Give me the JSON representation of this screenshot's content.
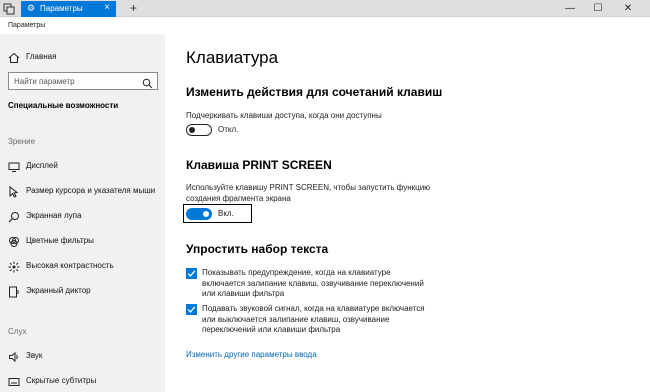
{
  "window": {
    "tab_title": "Параметры",
    "new_tab": "+",
    "app_title": "Параметры",
    "controls": {
      "minimize": "—",
      "maximize": "☐",
      "close": "✕"
    }
  },
  "sidebar": {
    "home": "Главная",
    "search_placeholder": "Найти параметр",
    "section": "Специальные возможности",
    "group_vision": "Зрение",
    "items_vision": [
      {
        "label": "Дисплей",
        "icon": "display-icon"
      },
      {
        "label": "Размер курсора и указателя мыши",
        "icon": "cursor-icon"
      },
      {
        "label": "Экранная лупа",
        "icon": "magnifier-icon"
      },
      {
        "label": "Цветные фильтры",
        "icon": "color-filter-icon"
      },
      {
        "label": "Высокая контрастность",
        "icon": "contrast-icon"
      },
      {
        "label": "Экранный диктор",
        "icon": "narrator-icon"
      }
    ],
    "group_hearing": "Слух",
    "items_hearing": [
      {
        "label": "Звук",
        "icon": "speaker-icon"
      },
      {
        "label": "Скрытые субтитры",
        "icon": "captions-icon"
      }
    ]
  },
  "main": {
    "title": "Клавиатура",
    "section1": {
      "heading": "Изменить действия для сочетаний клавиш",
      "desc": "Подчеркивать клавиши доступа, когда они доступны",
      "toggle_state": "Откл."
    },
    "section2": {
      "heading": "Клавиша PRINT SCREEN",
      "desc_line1": "Используйте клавишу PRINT SCREEN, чтобы запустить функцию",
      "desc_line2": "создания фрагмента экрана",
      "toggle_state": "Вкл."
    },
    "section3": {
      "heading": "Упростить набор текста",
      "check1_lines": [
        "Показывать предупреждение, когда на клавиатуре",
        "включается залипание клавиш, озвучивание переключений",
        "или клавиши фильтра"
      ],
      "check2_lines": [
        "Подавать звуковой сигнал, когда на клавиатуре включается",
        "или выключается залипание клавиш, озвучивание",
        "переключений или клавиши фильтра"
      ]
    },
    "link": "Изменить другие параметры ввода"
  },
  "colors": {
    "accent": "#0078d7",
    "sidebar_bg": "#f1f1f1",
    "link": "#0066b4"
  }
}
